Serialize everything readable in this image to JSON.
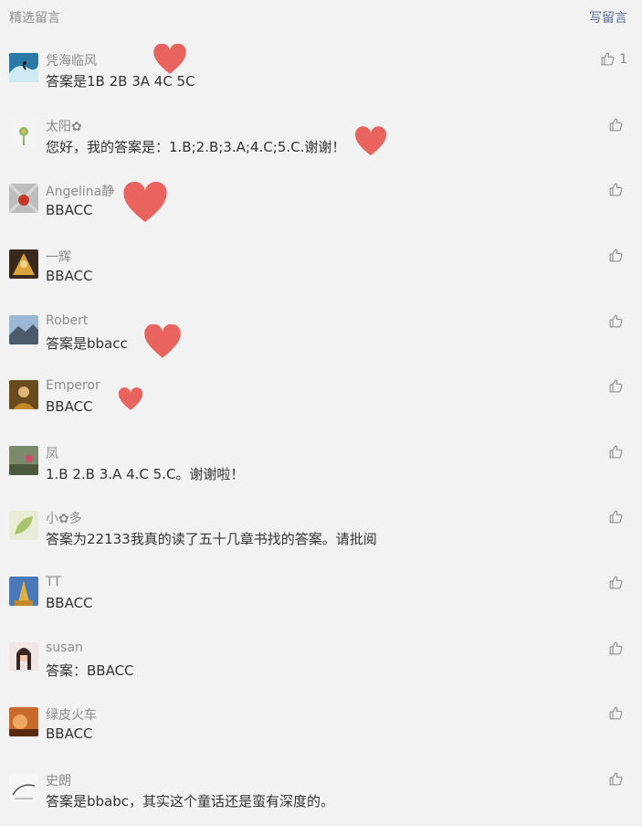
{
  "header": {
    "title": "精选留言",
    "write_label": "写留言"
  },
  "comments": [
    {
      "name": "凭海临风",
      "content": "答案是1B 2B 3A 4C 5C",
      "likes": "1",
      "avatar_icon": "surfer-wave-avatar"
    },
    {
      "name": "太阳✿",
      "content": "您好，我的答案是：1.B;2.B;3.A;4.C;5.C.谢谢！",
      "likes": "",
      "avatar_icon": "flower-avatar"
    },
    {
      "name": "Angelina静",
      "content": "BBACC",
      "likes": "",
      "avatar_icon": "grey-pattern-avatar"
    },
    {
      "name": "一辉",
      "content": "BBACC",
      "likes": "",
      "avatar_icon": "anime-warrior-avatar"
    },
    {
      "name": "Robert",
      "content": "答案是bbacc",
      "likes": "",
      "avatar_icon": "mountain-avatar"
    },
    {
      "name": "Emperor",
      "content": "BBACC",
      "likes": "",
      "avatar_icon": "portrait-avatar"
    },
    {
      "name": "凤",
      "content": "1.B 2.B 3.A 4.C 5.C。谢谢啦！",
      "likes": "",
      "avatar_icon": "outdoor-photo-avatar"
    },
    {
      "name": "小✿多",
      "content": "答案为22133我真的读了五十几章书找的答案。请批阅",
      "likes": "",
      "avatar_icon": "leaf-avatar"
    },
    {
      "name": "TT",
      "content": "BBACC",
      "likes": "",
      "avatar_icon": "golden-pagoda-avatar"
    },
    {
      "name": "susan",
      "content": "答案：BBACC",
      "likes": "",
      "avatar_icon": "girl-portrait-avatar"
    },
    {
      "name": "绿皮火车",
      "content": "BBACC",
      "likes": "",
      "avatar_icon": "sunset-avatar"
    },
    {
      "name": "史朗",
      "content": "答案是bbabc，其实这个童话还是蛮有深度的。",
      "likes": "",
      "avatar_icon": "sketch-avatar"
    }
  ],
  "colors": {
    "background": "#f2f2f2",
    "link": "#576b95",
    "heart": "#e8504a",
    "meta": "#8c8c8c"
  }
}
